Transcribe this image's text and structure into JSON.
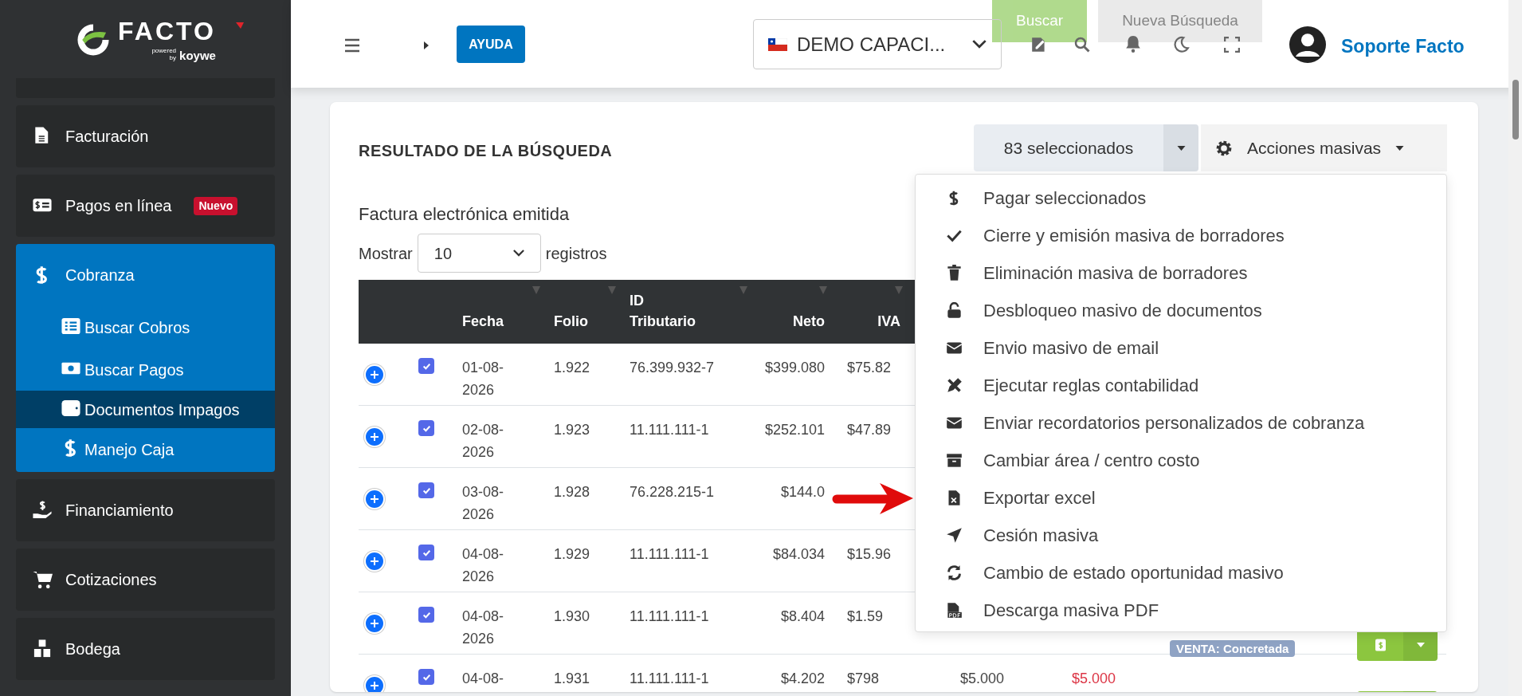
{
  "logo": {
    "name": "FACTO",
    "tagline_1": "powered",
    "tagline_2": "by",
    "brand": "koywe"
  },
  "sidebar": {
    "items": [
      {
        "label": "Facturación",
        "selected": false
      },
      {
        "label": "Pagos en línea",
        "badge": "Nuevo",
        "selected": false
      },
      {
        "label": "Cobranza",
        "selected": true,
        "children": [
          {
            "label": "Buscar Cobros",
            "selected": false
          },
          {
            "label": "Buscar Pagos",
            "selected": false
          },
          {
            "label": "Documentos Impagos",
            "selected": true
          },
          {
            "label": "Manejo Caja",
            "selected": false
          }
        ]
      },
      {
        "label": "Financiamiento",
        "selected": false
      },
      {
        "label": "Cotizaciones",
        "selected": false
      },
      {
        "label": "Bodega",
        "selected": false
      }
    ]
  },
  "header": {
    "background_buttons": [
      "Buscar",
      "Nueva Búsqueda"
    ],
    "help_button": "AYUDA",
    "company": "DEMO CAPACI...",
    "user": "Soporte Facto"
  },
  "card": {
    "title": "RESULTADO DE LA BÚSQUEDA",
    "selection_button": "83 seleccionados",
    "actions_button": "Acciones masivas",
    "subtitle": "Factura electrónica emitida",
    "show_label": "Mostrar",
    "page_size": "10",
    "records_label": "registros"
  },
  "actions_menu": {
    "items": [
      "Pagar seleccionados",
      "Cierre y emisión masiva de borradores",
      "Eliminación masiva de borradores",
      "Desbloqueo masivo de documentos",
      "Envio masivo de email",
      "Ejecutar reglas contabilidad",
      "Enviar recordatorios personalizados de cobranza",
      "Cambiar área / centro costo",
      "Exportar excel",
      "Cesión masiva",
      "Cambio de estado oportunidad masivo",
      "Descarga masiva PDF"
    ]
  },
  "table": {
    "columns": [
      "Fecha",
      "Folio",
      "ID Tributario",
      "Neto",
      "IVA"
    ],
    "rows": [
      {
        "checked": true,
        "fecha": "01-08-2026",
        "folio": "1.922",
        "id": "76.399.932-7",
        "neto": "$399.080",
        "iva": "$75.82",
        "action_button": false
      },
      {
        "checked": true,
        "fecha": "02-08-2026",
        "folio": "1.923",
        "id": "11.111.111-1",
        "neto": "$252.101",
        "iva": "$47.89",
        "action_button": false
      },
      {
        "checked": true,
        "fecha": "03-08-2026",
        "folio": "1.928",
        "id": "76.228.215-1",
        "neto": "$144.0",
        "action_button": false
      },
      {
        "checked": true,
        "fecha": "04-08-2026",
        "folio": "1.929",
        "id": "11.111.111-1",
        "neto": "$84.034",
        "iva": "$15.96",
        "action_button": false
      },
      {
        "checked": true,
        "fecha": "04-08-2026",
        "folio": "1.930",
        "id": "11.111.111-1",
        "neto": "$8.404",
        "iva": "$1.59",
        "estado": "VENTA: Concretada",
        "action_button": true
      },
      {
        "checked": true,
        "fecha": "04-08-",
        "folio": "1.931",
        "id": "11.111.111-1",
        "neto": "$4.202",
        "iva": "$798",
        "total": "$5.000",
        "saldo": "$5.000",
        "action_button": true
      }
    ]
  }
}
